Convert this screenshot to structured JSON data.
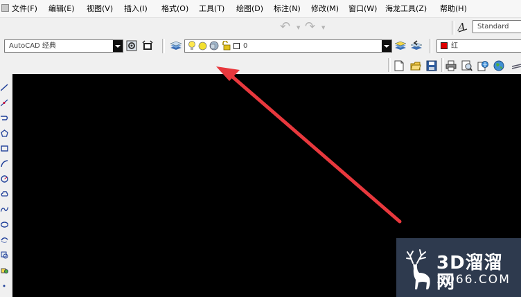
{
  "menu": {
    "items": [
      "文件(F)",
      "编辑(E)",
      "视图(V)",
      "插入(I)",
      "格式(O)",
      "工具(T)",
      "绘图(D)",
      "标注(N)",
      "修改(M)",
      "窗口(W)",
      "海龙工具(Z)",
      "帮助(H)"
    ]
  },
  "toolbar": {
    "text_style_value": "Standard",
    "workspace_value": "AutoCAD 经典",
    "layer_value": "0",
    "color_value": "红",
    "color_swatch": "#e00000"
  },
  "watermark": {
    "title": "3D溜溜网",
    "subtitle": "3D66.COM"
  },
  "colors": {
    "arrow": "#e8383d",
    "canvas": "#000000",
    "watermark_bg": "#2e3a4e"
  }
}
